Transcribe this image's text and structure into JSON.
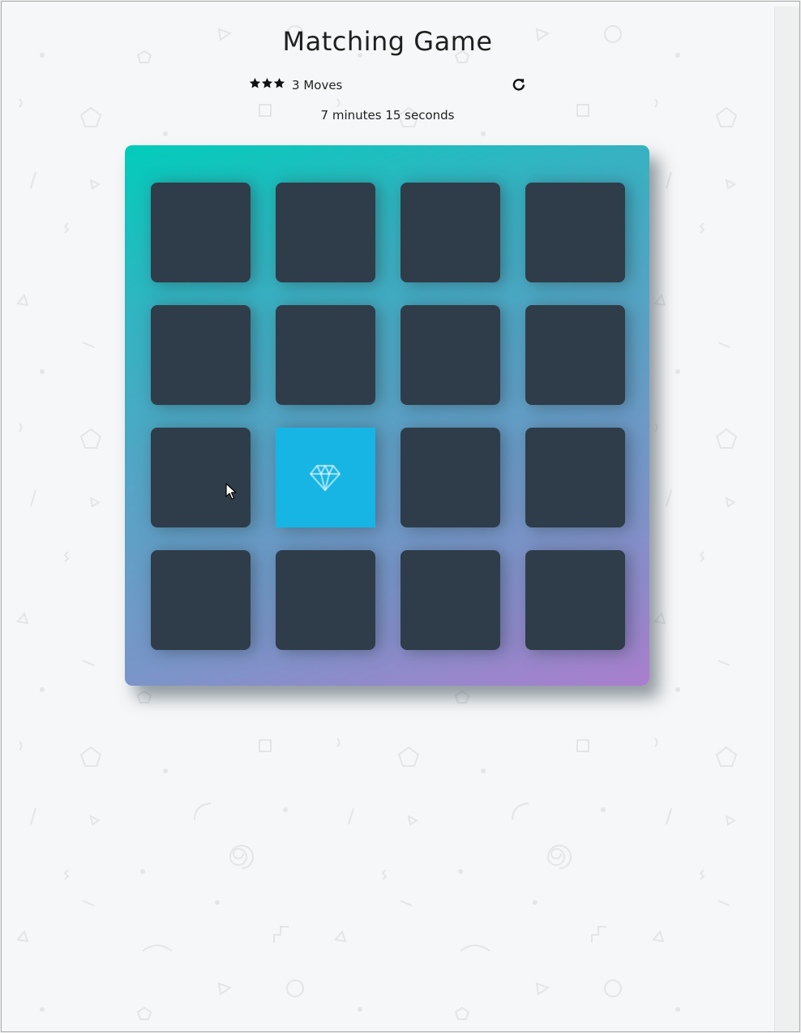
{
  "game": {
    "title": "Matching Game",
    "moves_count": "3",
    "moves_label": "Moves",
    "stars": 3,
    "timer_text": "7 minutes 15 seconds"
  },
  "icons": {
    "star": "star-icon",
    "restart": "repeat-icon",
    "revealed_card": "diamond-icon"
  },
  "deck": {
    "rows": 4,
    "columns": 4,
    "cards": [
      {
        "state": "hidden",
        "icon": ""
      },
      {
        "state": "hidden",
        "icon": ""
      },
      {
        "state": "hidden",
        "icon": ""
      },
      {
        "state": "hidden",
        "icon": ""
      },
      {
        "state": "hidden",
        "icon": ""
      },
      {
        "state": "hidden",
        "icon": ""
      },
      {
        "state": "hidden",
        "icon": ""
      },
      {
        "state": "hidden",
        "icon": ""
      },
      {
        "state": "hidden",
        "icon": ""
      },
      {
        "state": "open",
        "icon": "diamond-icon"
      },
      {
        "state": "hidden",
        "icon": ""
      },
      {
        "state": "hidden",
        "icon": ""
      },
      {
        "state": "hidden",
        "icon": ""
      },
      {
        "state": "hidden",
        "icon": ""
      },
      {
        "state": "hidden",
        "icon": ""
      },
      {
        "state": "hidden",
        "icon": ""
      }
    ]
  },
  "colors": {
    "card_back": "#2e3d49",
    "card_open": "#17b5e4",
    "deck_gradient_start": "#02ccba",
    "deck_gradient_end": "#aa7ecd",
    "page_background": "#f6f7f8"
  }
}
